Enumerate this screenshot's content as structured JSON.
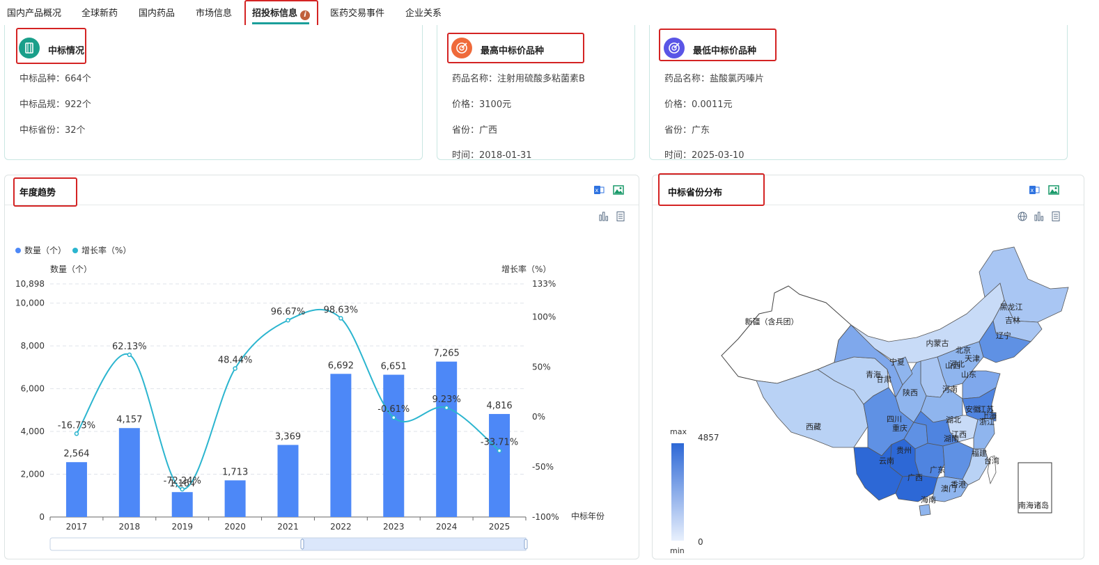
{
  "tabs": [
    {
      "label": "国内产品概况"
    },
    {
      "label": "全球新药"
    },
    {
      "label": "国内药品"
    },
    {
      "label": "市场信息"
    },
    {
      "label": "招投标信息",
      "active": true,
      "badge": "i"
    },
    {
      "label": "医药交易事件"
    },
    {
      "label": "企业关系"
    }
  ],
  "summary": {
    "title": "中标情况",
    "lines": [
      "中标品种：664个",
      "中标品规：922个",
      "中标省份：32个"
    ]
  },
  "highest": {
    "title": "最高中标价品种",
    "lines": [
      "药品名称：注射用硫酸多粘菌素B",
      "价格：3100元",
      "省份：广西",
      "时间：2018-01-31"
    ]
  },
  "lowest": {
    "title": "最低中标价品种",
    "lines": [
      "药品名称：盐酸氯丙嗪片",
      "价格：0.0011元",
      "省份：广东",
      "时间：2025-03-10"
    ]
  },
  "trend": {
    "title": "年度趋势",
    "legend": [
      "数量（个）",
      "增长率（%）"
    ],
    "left_axis_label": "数量（个）",
    "right_axis_label": "增长率（%）",
    "x_axis_label": "中标年份"
  },
  "map_panel": {
    "title": "中标省份分布",
    "scale_max_label": "max",
    "scale_min_label": "min",
    "scale_max_value": "4857",
    "scale_min_value": "0",
    "province_labels": [
      "新疆（含兵团）",
      "西藏",
      "青海",
      "甘肃",
      "宁夏",
      "内蒙古",
      "黑龙江",
      "吉林",
      "辽宁",
      "北京",
      "天津",
      "河北",
      "山西",
      "山东",
      "陕西",
      "河南",
      "四川",
      "重庆",
      "湖北",
      "安徽",
      "江苏",
      "上海",
      "浙江",
      "湖南",
      "江西",
      "贵州",
      "云南",
      "广西",
      "广东",
      "福建",
      "台湾",
      "香港",
      "澳门",
      "海南",
      "南海诸岛"
    ]
  },
  "colors": {
    "bar": "#4d88f7",
    "line": "#2bb5cf",
    "accent": "#1a9f9a",
    "highlight": "#d42323"
  },
  "chart_data": {
    "type": "bar",
    "categories": [
      "2017",
      "2018",
      "2019",
      "2020",
      "2021",
      "2022",
      "2023",
      "2024",
      "2025"
    ],
    "series": [
      {
        "name": "数量（个）",
        "type": "bar",
        "axis": "left",
        "values": [
          2564,
          4157,
          1164,
          1713,
          3369,
          6692,
          6651,
          7265,
          4816
        ],
        "labels": [
          "2,564",
          "4,157",
          "1,164",
          "1,713",
          "3,369",
          "6,692",
          "6,651",
          "7,265",
          "4,816"
        ]
      },
      {
        "name": "增长率（%）",
        "type": "line",
        "axis": "right",
        "values": [
          -16.73,
          62.13,
          -72.24,
          48.44,
          96.67,
          98.63,
          -0.61,
          9.23,
          -33.71
        ],
        "labels": [
          "-16.73%",
          "62.13%",
          "-72.24%",
          "48.44%",
          "96.67%",
          "98.63%",
          "-0.61%",
          "9.23%",
          "-33.71%"
        ]
      }
    ],
    "left_ylim": [
      0,
      10898
    ],
    "left_ticks": [
      "0",
      "2,000",
      "4,000",
      "6,000",
      "8,000",
      "10,000",
      "10,898"
    ],
    "right_ylim": [
      -100,
      133
    ],
    "right_ticks": [
      "-100%",
      "-50%",
      "0%",
      "50%",
      "100%",
      "133%"
    ],
    "grid": true,
    "legend": "top-left"
  }
}
